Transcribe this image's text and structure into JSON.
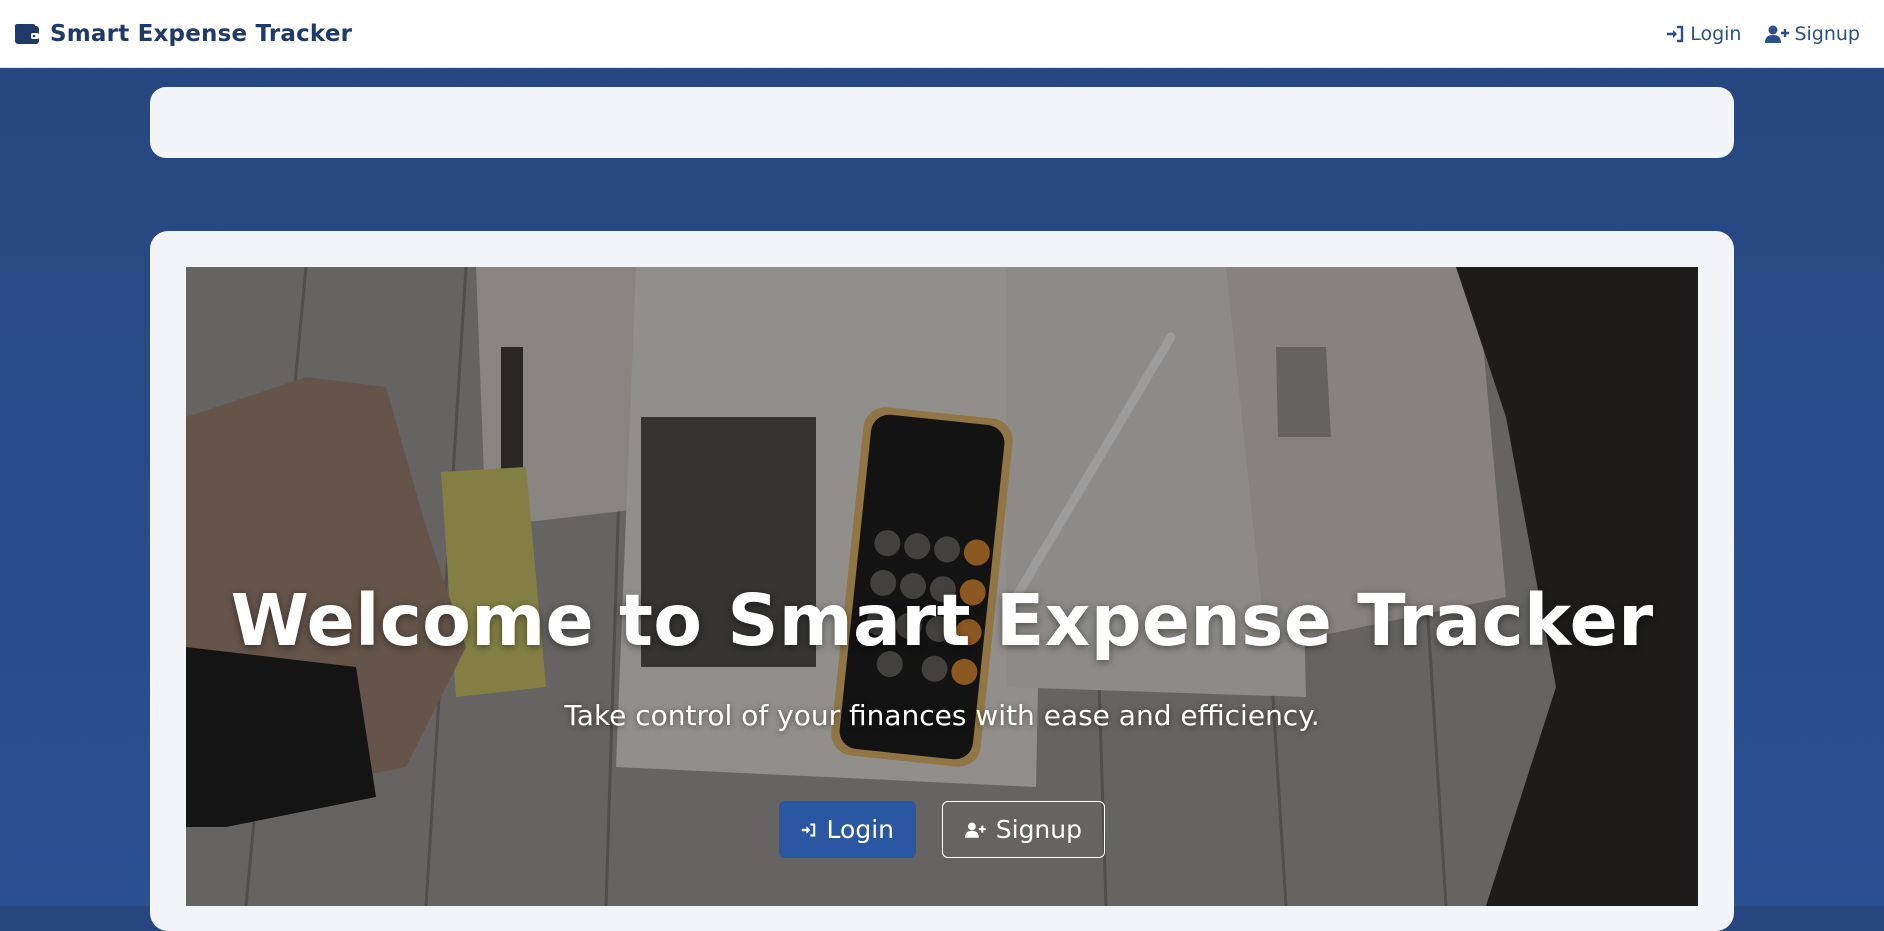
{
  "app": {
    "title": "Smart Expense Tracker",
    "brand_icon": "wallet-icon"
  },
  "nav": {
    "login_label": "Login",
    "login_icon": "sign-in-icon",
    "signup_label": "Signup",
    "signup_icon": "user-plus-icon"
  },
  "hero": {
    "title": "Welcome to Smart Expense Tracker",
    "subtitle": "Take control of your finances with ease and efficiency.",
    "login_button": "Login",
    "signup_button": "Signup"
  },
  "colors": {
    "navy": "#1f3a68",
    "accent": "#2b56a2",
    "background": "#2a4f92",
    "card": "#f3f4f8"
  }
}
